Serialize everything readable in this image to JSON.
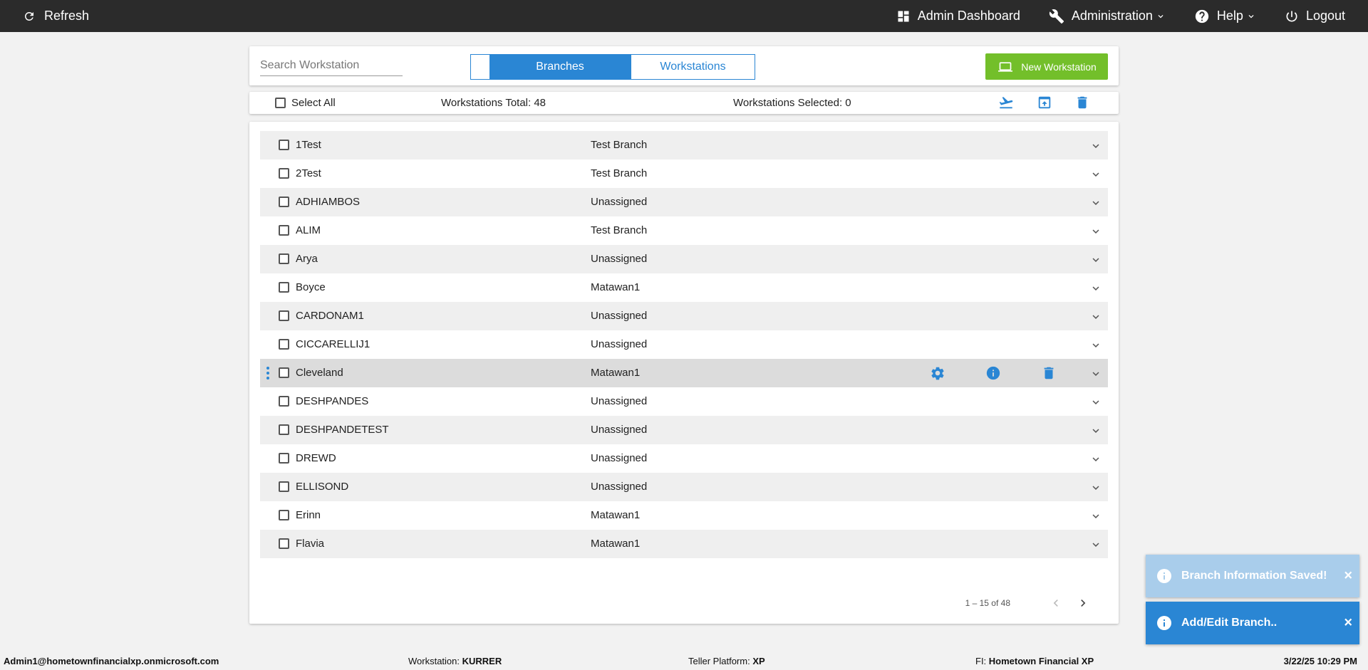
{
  "topbar": {
    "refresh": "Refresh",
    "admin_dashboard": "Admin Dashboard",
    "administration": "Administration",
    "help": "Help",
    "logout": "Logout"
  },
  "header": {
    "search_placeholder": "Search Workstation",
    "toggle_active": "Branches",
    "toggle_inactive": "Workstations",
    "new_workstation": "New Workstation"
  },
  "select_bar": {
    "select_all": "Select All",
    "total": "Workstations Total: 48",
    "selected": "Workstations Selected: 0"
  },
  "rows": [
    {
      "name": "1Test",
      "branch": "Test Branch"
    },
    {
      "name": "2Test",
      "branch": "Test Branch"
    },
    {
      "name": "ADHIAMBOS",
      "branch": "Unassigned"
    },
    {
      "name": "ALIM",
      "branch": "Test Branch"
    },
    {
      "name": "Arya",
      "branch": "Unassigned"
    },
    {
      "name": "Boyce",
      "branch": "Matawan1"
    },
    {
      "name": "CARDONAM1",
      "branch": "Unassigned"
    },
    {
      "name": "CICCARELLIJ1",
      "branch": "Unassigned"
    },
    {
      "name": "Cleveland",
      "branch": "Matawan1"
    },
    {
      "name": "DESHPANDES",
      "branch": "Unassigned"
    },
    {
      "name": "DESHPANDETEST",
      "branch": "Unassigned"
    },
    {
      "name": "DREWD",
      "branch": "Unassigned"
    },
    {
      "name": "ELLISOND",
      "branch": "Unassigned"
    },
    {
      "name": "Erinn",
      "branch": "Matawan1"
    },
    {
      "name": "Flavia",
      "branch": "Matawan1"
    }
  ],
  "paging": {
    "range": "1 – 15 of 48"
  },
  "toasts": {
    "saved": "Branch Information Saved!",
    "editing": "Add/Edit Branch..",
    "close": "×"
  },
  "footer": {
    "user": "Admin1@hometownfinancialxp.onmicrosoft.com",
    "workstation_label": "Workstation: ",
    "workstation": "KURRER",
    "platform_label": "Teller Platform: ",
    "platform": "XP",
    "fi_label": "FI: ",
    "fi": "Hometown Financial XP",
    "datetime": "3/22/25 10:29 PM"
  },
  "colors": {
    "topbar": "#2b2b2b",
    "accent": "#2a86d4",
    "new_button": "#73bf2a",
    "toast_faded": "#a9cdeb"
  }
}
